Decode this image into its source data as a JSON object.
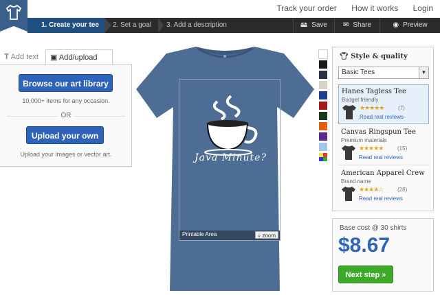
{
  "nav": {
    "links": [
      "Track your order",
      "How it works",
      "Login"
    ]
  },
  "steps": [
    {
      "label": "1. Create your tee"
    },
    {
      "label": "2. Set a goal"
    },
    {
      "label": "3. Add a description"
    }
  ],
  "toolbar": {
    "save": "Save",
    "share": "Share",
    "preview": "Preview"
  },
  "left_panel": {
    "tabs": [
      "Add text",
      "Add/upload art"
    ],
    "browse_button": "Browse our art library",
    "library_note": "10,000+ items for any occasion.",
    "or_label": "OR",
    "upload_button": "Upload your own",
    "upload_note": "Upload your images or vector art."
  },
  "canvas": {
    "design_text": "Java Minute?",
    "printable_label": "Printable Area",
    "zoom_label": "zoom",
    "shirt_color": "#4e6d94"
  },
  "colors": [
    "#ffffff",
    "#1a1a1a",
    "#2a3145",
    "#d9d4c8",
    "#1f3e8c",
    "#a01a1a",
    "#1e3a1e",
    "#e06010",
    "#5a2a8a",
    "#9ec8ea"
  ],
  "style_panel": {
    "title": "Style & quality",
    "selected_style": "Basic Tees",
    "products": [
      {
        "name": "Hanes Tagless Tee",
        "subtitle": "Budget friendly",
        "stars": "★★★★★",
        "count": "(7)",
        "reviews": "Read real reviews"
      },
      {
        "name": "Canvas Ringspun Tee",
        "subtitle": "Premium materials",
        "stars": "★★★★★",
        "count": "(15)",
        "reviews": "Read real reviews"
      },
      {
        "name": "American Apparel Crew",
        "subtitle": "Brand name",
        "stars": "★★★★☆",
        "count": "(28)",
        "reviews": "Read real reviews"
      }
    ]
  },
  "cost": {
    "label": "Base cost @ 30 shirts",
    "price": "$8.67",
    "next_button": "Next step »"
  }
}
